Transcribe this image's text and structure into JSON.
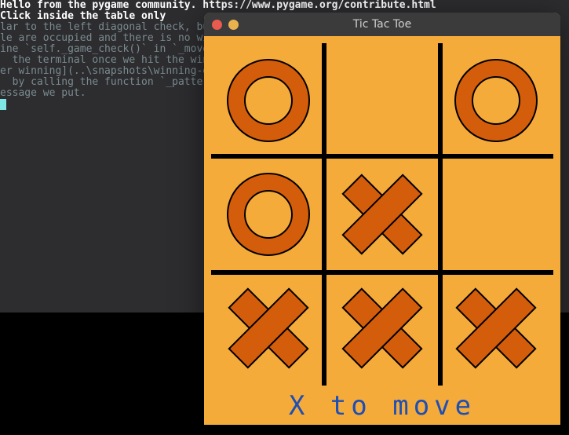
{
  "terminal": {
    "lines": [
      {
        "t": "Hello from the pygame community. https://www.pygame.org/contribute.html",
        "cls": "term-bold"
      },
      {
        "t": "Click inside the table only",
        "cls": "term-bold"
      },
      {
        "t": "lar to the left diagonal check, but                                       ce",
        "cls": ""
      },
      {
        "t": "le are occupied and there is no winn",
        "cls": ""
      },
      {
        "t": "",
        "cls": ""
      },
      {
        "t": "",
        "cls": ""
      },
      {
        "t": "ine `self._game_check()` in `_move()                                     ll",
        "cls": ""
      },
      {
        "t": "  the terminal once we hit the winnin",
        "cls": ""
      },
      {
        "t": "",
        "cls": ""
      },
      {
        "t": "er winning](..\\snapshots\\winning-err",
        "cls": ""
      },
      {
        "t": "",
        "cls": ""
      },
      {
        "t": "  by calling the function `_pattern_s                                    s",
        "cls": ""
      },
      {
        "t": "essage we put.",
        "cls": ""
      }
    ]
  },
  "window": {
    "title": "Tic Tac Toe"
  },
  "game": {
    "status": "X to move",
    "board": [
      "O",
      "",
      "O",
      "O",
      "X",
      "",
      "X",
      "X",
      "X"
    ]
  },
  "colors": {
    "board_bg": "#f5ab39",
    "piece_fill": "#d35d0a",
    "piece_stroke": "#000000",
    "grid": "#000000",
    "status_text": "#1e4fb5"
  }
}
